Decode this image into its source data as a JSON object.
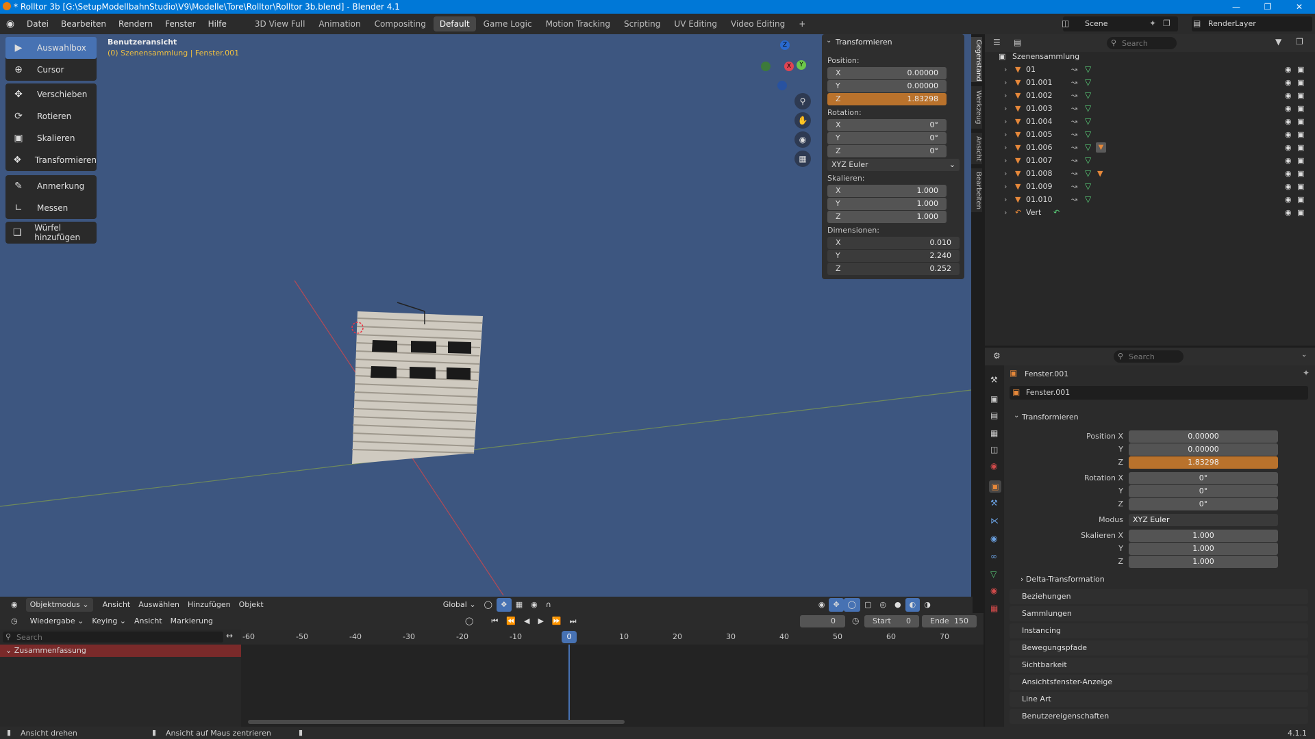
{
  "window": {
    "title": "* Rolltor 3b [G:\\SetupModellbahnStudio\\V9\\Modelle\\Tore\\Rolltor\\Rolltor 3b.blend] - Blender 4.1"
  },
  "menu": [
    "Datei",
    "Bearbeiten",
    "Rendern",
    "Fenster",
    "Hilfe"
  ],
  "workspaces": [
    {
      "label": "3D View Full",
      "active": false
    },
    {
      "label": "Animation",
      "active": false
    },
    {
      "label": "Compositing",
      "active": false
    },
    {
      "label": "Default",
      "active": true
    },
    {
      "label": "Game Logic",
      "active": false
    },
    {
      "label": "Motion Tracking",
      "active": false
    },
    {
      "label": "Scripting",
      "active": false
    },
    {
      "label": "UV Editing",
      "active": false
    },
    {
      "label": "Video Editing",
      "active": false
    },
    {
      "label": "+",
      "active": false
    }
  ],
  "scene": {
    "name": "Scene",
    "renderlayer": "RenderLayer"
  },
  "toolbar": {
    "groups": [
      [
        {
          "label": "Auswahlbox",
          "icon": "select-box-icon",
          "active": true
        },
        {
          "label": "Cursor",
          "icon": "cursor-icon",
          "active": false
        }
      ],
      [
        {
          "label": "Verschieben",
          "icon": "move-icon"
        },
        {
          "label": "Rotieren",
          "icon": "rotate-icon"
        },
        {
          "label": "Skalieren",
          "icon": "scale-icon"
        },
        {
          "label": "Transformieren",
          "icon": "transform-icon"
        }
      ],
      [
        {
          "label": "Anmerkung",
          "icon": "annotate-icon"
        },
        {
          "label": "Messen",
          "icon": "measure-icon"
        }
      ],
      [
        {
          "label": "Würfel hinzufügen",
          "icon": "add-cube-icon"
        }
      ]
    ]
  },
  "viewport": {
    "view_name": "Benutzeransicht",
    "context": "(0) Szenensammlung | Fenster.001",
    "gizmo": {
      "x": "X",
      "y": "Y",
      "z": "Z"
    }
  },
  "npanel": {
    "title": "Transformieren",
    "position_label": "Position:",
    "position": [
      {
        "axis": "X",
        "value": "0.00000"
      },
      {
        "axis": "Y",
        "value": "0.00000"
      },
      {
        "axis": "Z",
        "value": "1.83298"
      }
    ],
    "rotation_label": "Rotation:",
    "rotation": [
      {
        "axis": "X",
        "value": "0°"
      },
      {
        "axis": "Y",
        "value": "0°"
      },
      {
        "axis": "Z",
        "value": "0°"
      }
    ],
    "rotation_mode": "XYZ Euler",
    "scale_label": "Skalieren:",
    "scale": [
      {
        "axis": "X",
        "value": "1.000"
      },
      {
        "axis": "Y",
        "value": "1.000"
      },
      {
        "axis": "Z",
        "value": "1.000"
      }
    ],
    "dimensions_label": "Dimensionen:",
    "dimensions": [
      {
        "axis": "X",
        "value": "0.010"
      },
      {
        "axis": "Y",
        "value": "2.240"
      },
      {
        "axis": "Z",
        "value": "0.252"
      }
    ],
    "tabs": [
      "Gegenstand",
      "Werkzeug",
      "Ansicht",
      "Bearbeiten"
    ]
  },
  "outliner": {
    "search_placeholder": "Search",
    "collection": "Szenensammlung",
    "items": [
      "01",
      "01.001",
      "01.002",
      "01.003",
      "01.004",
      "01.005",
      "01.006",
      "01.007",
      "01.008",
      "01.009",
      "01.010",
      "Vert"
    ]
  },
  "properties": {
    "search_placeholder": "Search",
    "object_name": "Fenster.001",
    "data_name": "Fenster.001",
    "section": "Transformieren",
    "position_x_label": "Position X",
    "rotation_x_label": "Rotation X",
    "scale_x_label": "Skalieren X",
    "y_label": "Y",
    "z_label": "Z",
    "mode_label": "Modus",
    "position": [
      "0.00000",
      "0.00000",
      "1.83298"
    ],
    "rotation": [
      "0°",
      "0°",
      "0°"
    ],
    "mode": "XYZ Euler",
    "scale": [
      "1.000",
      "1.000",
      "1.000"
    ],
    "delta": "Delta-Transformation",
    "subpanels": [
      "Beziehungen",
      "Sammlungen",
      "Instancing",
      "Bewegungspfade",
      "Sichtbarkeit",
      "Ansichtsfenster-Anzeige",
      "Line Art",
      "Benutzereigenschaften"
    ]
  },
  "viewport_header": {
    "mode": "Objektmodus",
    "menus": [
      "Ansicht",
      "Auswählen",
      "Hinzufügen",
      "Objekt"
    ],
    "transform_space": "Global"
  },
  "timeline": {
    "menus": [
      "Wiedergabe",
      "Keying",
      "Ansicht",
      "Markierung"
    ],
    "current_frame": "0",
    "start_label": "Start",
    "start": "0",
    "end_label": "Ende",
    "end": "150",
    "search_placeholder": "Search",
    "summary": "Zusammenfassung",
    "ruler": [
      "-60",
      "-50",
      "-40",
      "-30",
      "-20",
      "-10",
      "0",
      "10",
      "20",
      "30",
      "40",
      "50",
      "60",
      "70"
    ]
  },
  "status": {
    "left": "Ansicht drehen",
    "middle": "Ansicht auf Maus zentrieren",
    "version": "4.1.1"
  }
}
